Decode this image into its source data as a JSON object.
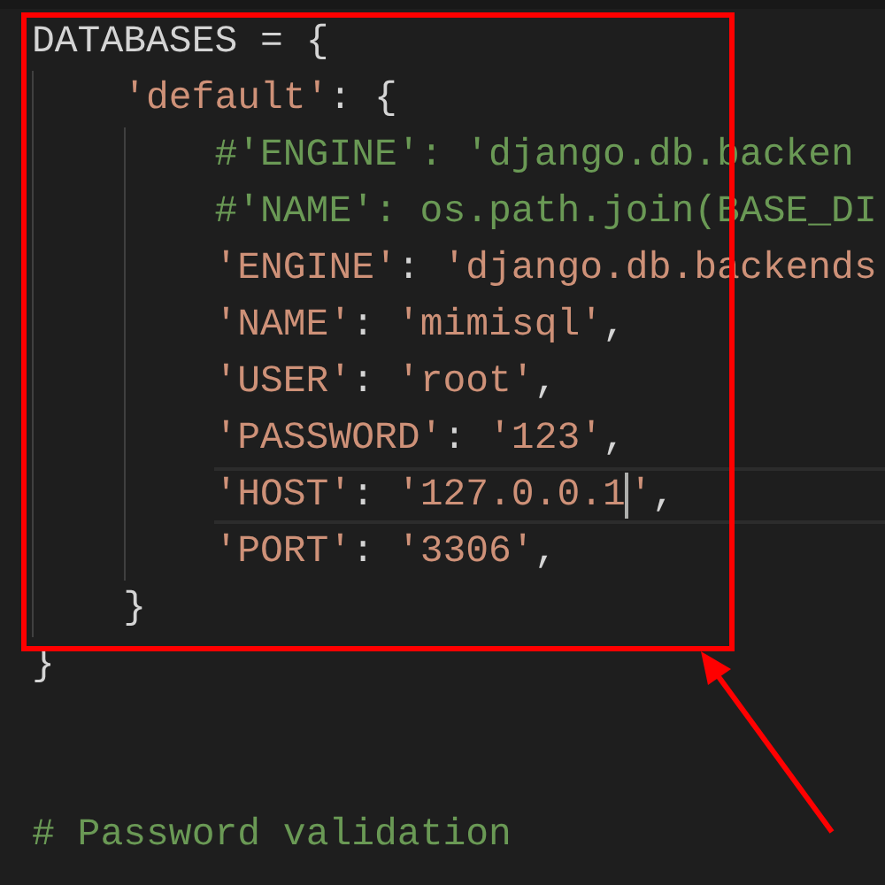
{
  "editor": {
    "lines": [
      {
        "kind": "code",
        "tokens": [
          {
            "kind": "name",
            "text": "DATABASES"
          },
          {
            "kind": "punct",
            "text": " = {"
          }
        ],
        "children": [
          {
            "kind": "code",
            "tokens": [
              {
                "kind": "string",
                "text": "'default'"
              },
              {
                "kind": "punct",
                "text": ": {"
              }
            ],
            "children": [
              {
                "kind": "code",
                "tokens": [
                  {
                    "kind": "comment",
                    "text": "#'ENGINE': 'django.db.backen"
                  }
                ]
              },
              {
                "kind": "code",
                "tokens": [
                  {
                    "kind": "comment",
                    "text": "#'NAME': os.path.join(BASE_DI"
                  }
                ]
              },
              {
                "kind": "code",
                "tokens": [
                  {
                    "kind": "string",
                    "text": "'ENGINE'"
                  },
                  {
                    "kind": "punct",
                    "text": ": "
                  },
                  {
                    "kind": "string",
                    "text": "'django.db.backends"
                  }
                ]
              },
              {
                "kind": "code",
                "tokens": [
                  {
                    "kind": "string",
                    "text": "'NAME'"
                  },
                  {
                    "kind": "punct",
                    "text": ": "
                  },
                  {
                    "kind": "string",
                    "text": "'mimisql'"
                  },
                  {
                    "kind": "punct",
                    "text": ","
                  }
                ]
              },
              {
                "kind": "code",
                "tokens": [
                  {
                    "kind": "string",
                    "text": "'USER'"
                  },
                  {
                    "kind": "punct",
                    "text": ": "
                  },
                  {
                    "kind": "string",
                    "text": "'root'"
                  },
                  {
                    "kind": "punct",
                    "text": ","
                  }
                ]
              },
              {
                "kind": "code",
                "tokens": [
                  {
                    "kind": "string",
                    "text": "'PASSWORD'"
                  },
                  {
                    "kind": "punct",
                    "text": ": "
                  },
                  {
                    "kind": "string",
                    "text": "'123'"
                  },
                  {
                    "kind": "punct",
                    "text": ","
                  }
                ]
              },
              {
                "kind": "code",
                "current": true,
                "tokens": [
                  {
                    "kind": "string",
                    "text": "'HOST'"
                  },
                  {
                    "kind": "punct",
                    "text": ": "
                  },
                  {
                    "kind": "string",
                    "text": "'127.0.0.1"
                  },
                  {
                    "kind": "cursor"
                  },
                  {
                    "kind": "string",
                    "text": "'"
                  },
                  {
                    "kind": "punct",
                    "text": ","
                  }
                ]
              },
              {
                "kind": "code",
                "tokens": [
                  {
                    "kind": "string",
                    "text": "'PORT'"
                  },
                  {
                    "kind": "punct",
                    "text": ": "
                  },
                  {
                    "kind": "string",
                    "text": "'3306'"
                  },
                  {
                    "kind": "punct",
                    "text": ","
                  }
                ]
              }
            ]
          },
          {
            "kind": "code",
            "tokens": [
              {
                "kind": "punct",
                "text": "}"
              }
            ]
          }
        ]
      },
      {
        "kind": "code",
        "tokens": [
          {
            "kind": "punct",
            "text": "}"
          }
        ]
      },
      {
        "kind": "blank"
      },
      {
        "kind": "blank"
      },
      {
        "kind": "code",
        "tokens": [
          {
            "kind": "comment",
            "text": "# Password validation"
          }
        ]
      }
    ]
  }
}
